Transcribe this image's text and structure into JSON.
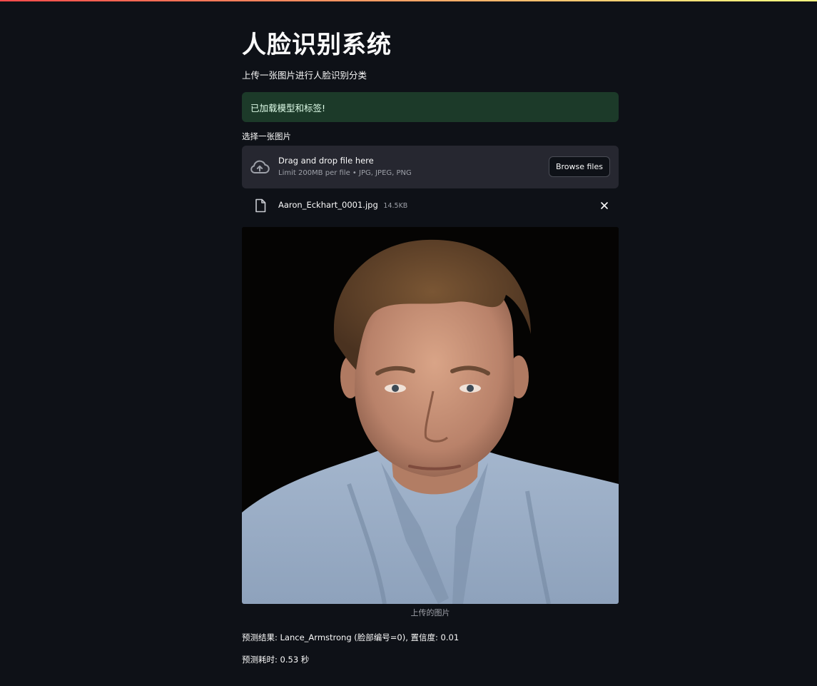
{
  "app": {
    "title": "人脸识别系统",
    "subtitle": "上传一张图片进行人脸识别分类"
  },
  "alert": {
    "message": "已加载模型和标签!"
  },
  "uploader": {
    "label": "选择一张图片",
    "drop_text": "Drag and drop file here",
    "limit_text": "Limit 200MB per file • JPG, JPEG, PNG",
    "browse_label": "Browse files",
    "icon": "cloud-upload-icon"
  },
  "uploaded_file": {
    "name": "Aaron_Eckhart_0001.jpg",
    "size": "14.5KB",
    "icon": "file-icon"
  },
  "image": {
    "caption": "上传的图片"
  },
  "results": {
    "prediction": "预测结果: Lance_Armstrong (脸部编号=0), 置信度: 0.01",
    "elapsed": "预测耗时: 0.53 秒"
  },
  "colors": {
    "background": "#0e1117",
    "success_bg": "#1c3a29",
    "dropzone_bg": "#262730",
    "muted_text": "#9da0a8"
  }
}
